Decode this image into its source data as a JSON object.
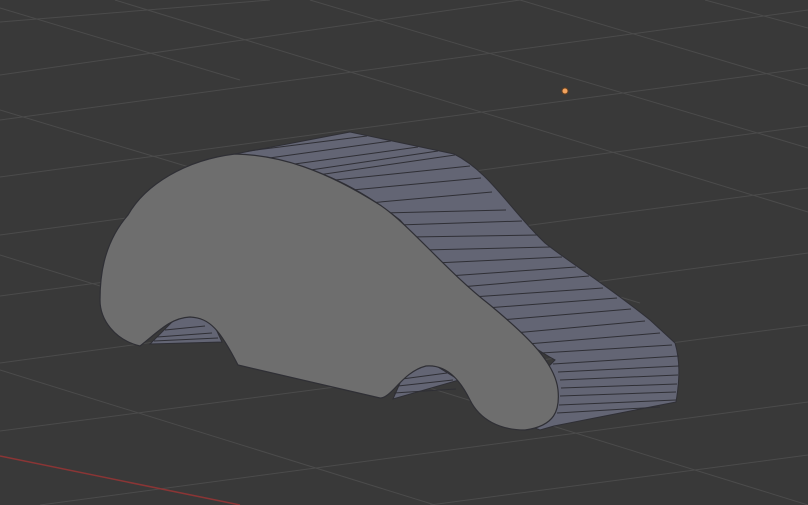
{
  "viewport": {
    "mode": "3D Viewport",
    "background_color": "#393939",
    "grid_color": "#4b4b4b",
    "x_axis_color": "#8a3535",
    "object_face_color": "#6e6e6e",
    "object_side_color": "#636574",
    "edge_color": "#2f2f35",
    "light_color": "#f2a35e"
  },
  "objects": [
    {
      "name": "car-silhouette-mesh",
      "kind": "extruded-mesh"
    },
    {
      "name": "lamp",
      "kind": "light"
    }
  ]
}
